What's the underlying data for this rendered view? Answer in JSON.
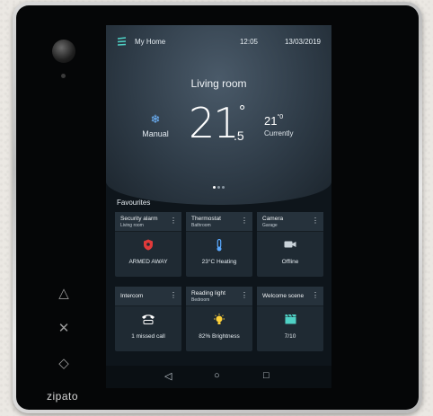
{
  "brand": "zipato",
  "topbar": {
    "title": "My Home",
    "time": "12:05",
    "date": "13/03/2019"
  },
  "hero": {
    "room": "Living room",
    "mode_label": "Manual",
    "setpoint_whole": "21",
    "setpoint_degree": "°",
    "setpoint_fraction": ".5",
    "current_temp": "21",
    "current_degree": "°",
    "current_fraction": "0",
    "current_label": "Currently"
  },
  "favourites": {
    "title": "Favourites",
    "tiles": [
      {
        "name": "Security alarm",
        "sub": "Living room",
        "icon": "shield-icon",
        "status": "ARMED AWAY",
        "icon_color": "#e03a3a"
      },
      {
        "name": "Thermostat",
        "sub": "Bathroom",
        "icon": "thermometer-icon",
        "status": "23°C Heating",
        "icon_color": "#5aa9ff"
      },
      {
        "name": "Camera",
        "sub": "Garage",
        "icon": "camera-icon",
        "status": "Offline",
        "icon_color": "#c9d2d9"
      },
      {
        "name": "Intercom",
        "sub": "",
        "icon": "phone-icon",
        "status": "1 missed call",
        "icon_color": "#ffffff"
      },
      {
        "name": "Reading light",
        "sub": "Bedroom",
        "icon": "bulb-icon",
        "status": "82% Brightness",
        "icon_color": "#ffd23a"
      },
      {
        "name": "Welcome scene",
        "sub": "",
        "icon": "clapper-icon",
        "status": "7/10",
        "icon_color": "#4fd1c5"
      }
    ]
  },
  "navbar": {
    "back": "◁",
    "home": "○",
    "recent": "□"
  },
  "hardware_buttons": {
    "up": "△",
    "cancel": "✕",
    "confirm": "◇"
  }
}
